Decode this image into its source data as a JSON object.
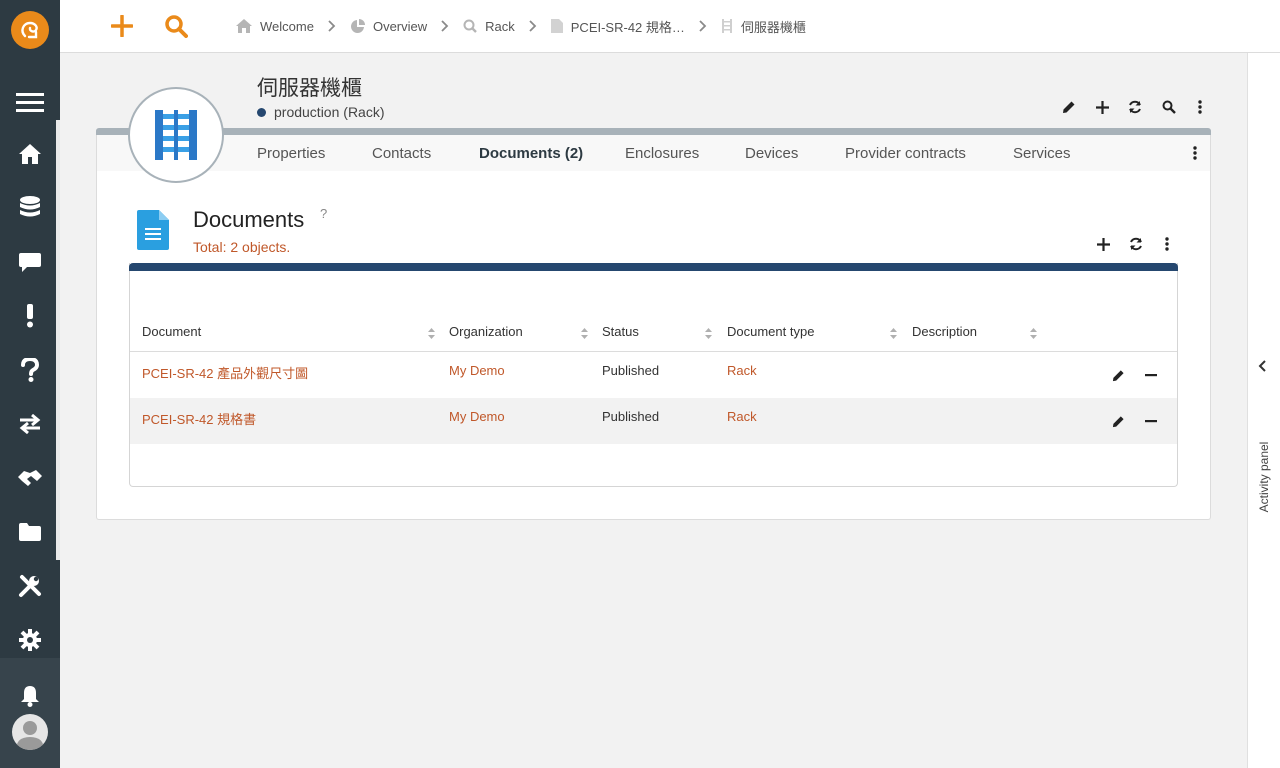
{
  "colors": {
    "sidebar": "#2d3a42",
    "accent_orange": "#ea8a1a",
    "link": "#c0582a",
    "table_header_bar": "#25476f",
    "status_dot": "#25476f"
  },
  "sidebar": {
    "items": [
      {
        "name": "home",
        "icon": "home-icon"
      },
      {
        "name": "database",
        "icon": "database-icon"
      },
      {
        "name": "messages",
        "icon": "chat-icon"
      },
      {
        "name": "alerts",
        "icon": "exclamation-icon"
      },
      {
        "name": "help",
        "icon": "question-icon"
      },
      {
        "name": "transfer",
        "icon": "arrows-icon"
      },
      {
        "name": "partners",
        "icon": "handshake-icon"
      },
      {
        "name": "files",
        "icon": "folder-icon"
      },
      {
        "name": "tools",
        "icon": "tools-icon"
      },
      {
        "name": "settings",
        "icon": "gear-icon"
      }
    ]
  },
  "breadcrumb": [
    {
      "label": "Welcome",
      "icon": "home-icon"
    },
    {
      "label": "Overview",
      "icon": "pie-chart-icon"
    },
    {
      "label": "Rack",
      "icon": "search-icon"
    },
    {
      "label": "PCEI-SR-42 規格…",
      "icon": "document-icon"
    },
    {
      "label": "伺服器機櫃",
      "icon": "rack-icon"
    }
  ],
  "object": {
    "title": "伺服器機櫃",
    "status": "production",
    "type": "(Rack)"
  },
  "tabs": [
    {
      "label": "Properties",
      "active": false
    },
    {
      "label": "Contacts",
      "active": false
    },
    {
      "label": "Documents (2)",
      "active": true
    },
    {
      "label": "Enclosures",
      "active": false
    },
    {
      "label": "Devices",
      "active": false
    },
    {
      "label": "Provider contracts",
      "active": false
    },
    {
      "label": "Services",
      "active": false
    }
  ],
  "documents": {
    "title": "Documents",
    "help": "?",
    "total_label": "Total: 2 objects.",
    "columns": [
      "Document",
      "Organization",
      "Status",
      "Document type",
      "Description"
    ],
    "rows": [
      {
        "document": "PCEI-SR-42 產品外觀尺寸圖",
        "organization": "My Demo",
        "status": "Published",
        "type": "Rack",
        "description": ""
      },
      {
        "document": "PCEI-SR-42 規格書",
        "organization": "My Demo",
        "status": "Published",
        "type": "Rack",
        "description": ""
      }
    ]
  },
  "activity_panel": {
    "label": "Activity panel"
  }
}
